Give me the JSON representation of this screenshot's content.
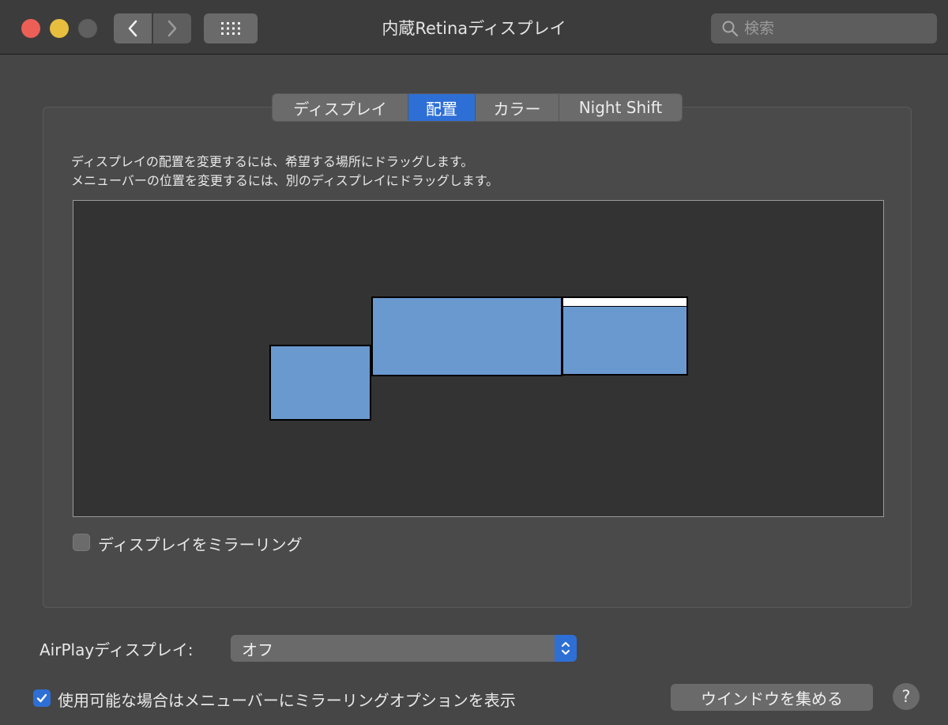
{
  "window": {
    "title": "内蔵Retinaディスプレイ",
    "search_placeholder": "検索"
  },
  "tabs": [
    {
      "label": "ディスプレイ",
      "active": false
    },
    {
      "label": "配置",
      "active": true
    },
    {
      "label": "カラー",
      "active": false
    },
    {
      "label": "Night Shift",
      "active": false
    }
  ],
  "arrangement": {
    "instructions_line1": "ディスプレイの配置を変更するには、希望する場所にドラッグします。",
    "instructions_line2": "メニューバーの位置を変更するには、別のディスプレイにドラッグします。",
    "display_count": 3,
    "menubar_display": "right display"
  },
  "mirror_checkbox": {
    "label": "ディスプレイをミラーリング",
    "checked": false
  },
  "airplay": {
    "label": "AirPlayディスプレイ:",
    "value": "オフ"
  },
  "menubar_option_checkbox": {
    "label": "使用可能な場合はメニューバーにミラーリングオプションを表示",
    "checked": true
  },
  "gather_button": {
    "label": "ウインドウを集める"
  },
  "help_button": {
    "label": "?"
  },
  "colors": {
    "accent": "#2e6fd6",
    "display_fill": "#6a99cf",
    "close": "#ec5f57",
    "minimize": "#e7be3e"
  }
}
